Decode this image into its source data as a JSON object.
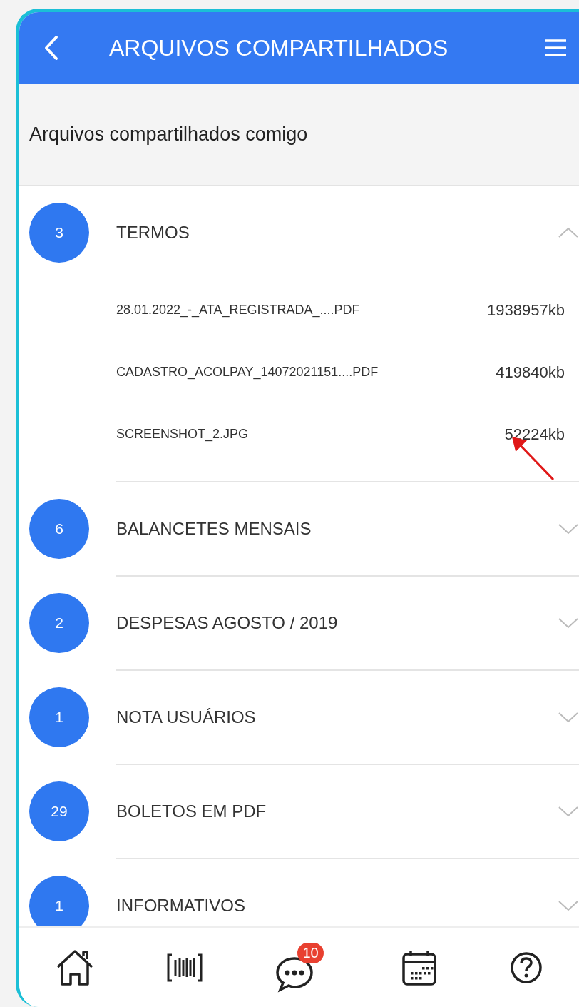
{
  "header": {
    "title": "ARQUIVOS COMPARTILHADOS"
  },
  "subheader": "Arquivos compartilhados comigo",
  "folders": [
    {
      "count": "3",
      "title": "TERMOS",
      "expanded": true,
      "files": [
        {
          "name": "28.01.2022_-_ATA_REGISTRADA_....PDF",
          "size": "1938957kb",
          "annotated": false
        },
        {
          "name": "CADASTRO_ACOLPAY_14072021151....PDF",
          "size": "419840kb",
          "annotated": false
        },
        {
          "name": "SCREENSHOT_2.JPG",
          "size": "52224kb",
          "annotated": true
        }
      ]
    },
    {
      "count": "6",
      "title": "BALANCETES MENSAIS",
      "expanded": false
    },
    {
      "count": "2",
      "title": "DESPESAS AGOSTO / 2019",
      "expanded": false
    },
    {
      "count": "1",
      "title": "NOTA USUÁRIOS",
      "expanded": false
    },
    {
      "count": "29",
      "title": "BOLETOS EM PDF",
      "expanded": false
    },
    {
      "count": "1",
      "title": "INFORMATIVOS",
      "expanded": false
    }
  ],
  "bottom_nav": [
    {
      "kind": "home"
    },
    {
      "kind": "barcode"
    },
    {
      "kind": "chat",
      "badge": "10"
    },
    {
      "kind": "calendar"
    },
    {
      "kind": "help"
    }
  ]
}
